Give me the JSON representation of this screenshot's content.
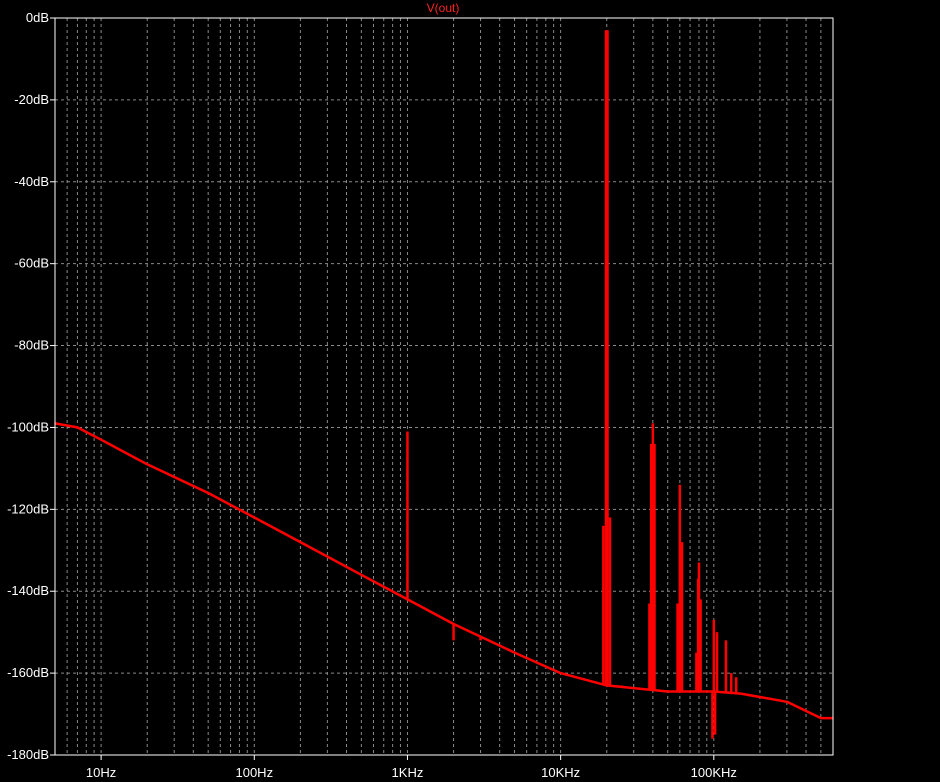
{
  "chart_data": {
    "type": "line",
    "title": "V(out)",
    "xscale": "log",
    "xlim": [
      5,
      600000
    ],
    "ylim": [
      -180,
      0
    ],
    "grid": true,
    "colors": {
      "background": "#000000",
      "frame": "#ffffff",
      "grid": "#8a8a8a",
      "trace": "#ff0000",
      "title": "#ff2020",
      "tick_label": "#ffffff"
    },
    "y_ticks": [
      {
        "value": 0,
        "label": "0dB"
      },
      {
        "value": -20,
        "label": "-20dB"
      },
      {
        "value": -40,
        "label": "-40dB"
      },
      {
        "value": -60,
        "label": "-60dB"
      },
      {
        "value": -80,
        "label": "-80dB"
      },
      {
        "value": -100,
        "label": "-100dB"
      },
      {
        "value": -120,
        "label": "-120dB"
      },
      {
        "value": -140,
        "label": "-140dB"
      },
      {
        "value": -160,
        "label": "-160dB"
      },
      {
        "value": -180,
        "label": "-180dB"
      }
    ],
    "x_ticks": [
      {
        "value": 10,
        "label": "10Hz"
      },
      {
        "value": 100,
        "label": "100Hz"
      },
      {
        "value": 1000,
        "label": "1KHz"
      },
      {
        "value": 10000,
        "label": "10KHz"
      },
      {
        "value": 100000,
        "label": "100KHz"
      }
    ],
    "series": [
      {
        "name": "V(out)",
        "baseline": [
          [
            5,
            -99
          ],
          [
            7,
            -100
          ],
          [
            10,
            -103
          ],
          [
            20,
            -109
          ],
          [
            50,
            -116
          ],
          [
            100,
            -122
          ],
          [
            200,
            -128
          ],
          [
            500,
            -136
          ],
          [
            1000,
            -142
          ],
          [
            2000,
            -148
          ],
          [
            5000,
            -155
          ],
          [
            10000,
            -160
          ],
          [
            20000,
            -163
          ],
          [
            50000,
            -164.5
          ],
          [
            100000,
            -164.5
          ],
          [
            150000,
            -165
          ],
          [
            300000,
            -167
          ],
          [
            500000,
            -171
          ],
          [
            600000,
            -171
          ]
        ],
        "spikes": [
          {
            "f": 1000,
            "y": -101
          },
          {
            "f": 2000,
            "y": -152
          },
          {
            "f": 3000,
            "y": -152
          },
          {
            "f": 19000,
            "y": -124
          },
          {
            "f": 20000,
            "y": -3
          },
          {
            "f": 21000,
            "y": -122
          },
          {
            "f": 25000,
            "y": -163
          },
          {
            "f": 38000,
            "y": -143
          },
          {
            "f": 39000,
            "y": -104
          },
          {
            "f": 40000,
            "y": -99
          },
          {
            "f": 41000,
            "y": -104
          },
          {
            "f": 58000,
            "y": -143
          },
          {
            "f": 60000,
            "y": -114
          },
          {
            "f": 62000,
            "y": -128
          },
          {
            "f": 77000,
            "y": -155
          },
          {
            "f": 79000,
            "y": -137
          },
          {
            "f": 80000,
            "y": -133
          },
          {
            "f": 82000,
            "y": -142
          },
          {
            "f": 98000,
            "y": -176
          },
          {
            "f": 100000,
            "y": -147
          },
          {
            "f": 102000,
            "y": -175
          },
          {
            "f": 105000,
            "y": -150
          },
          {
            "f": 120000,
            "y": -152
          },
          {
            "f": 130000,
            "y": -160
          },
          {
            "f": 140000,
            "y": -161
          }
        ]
      }
    ]
  }
}
